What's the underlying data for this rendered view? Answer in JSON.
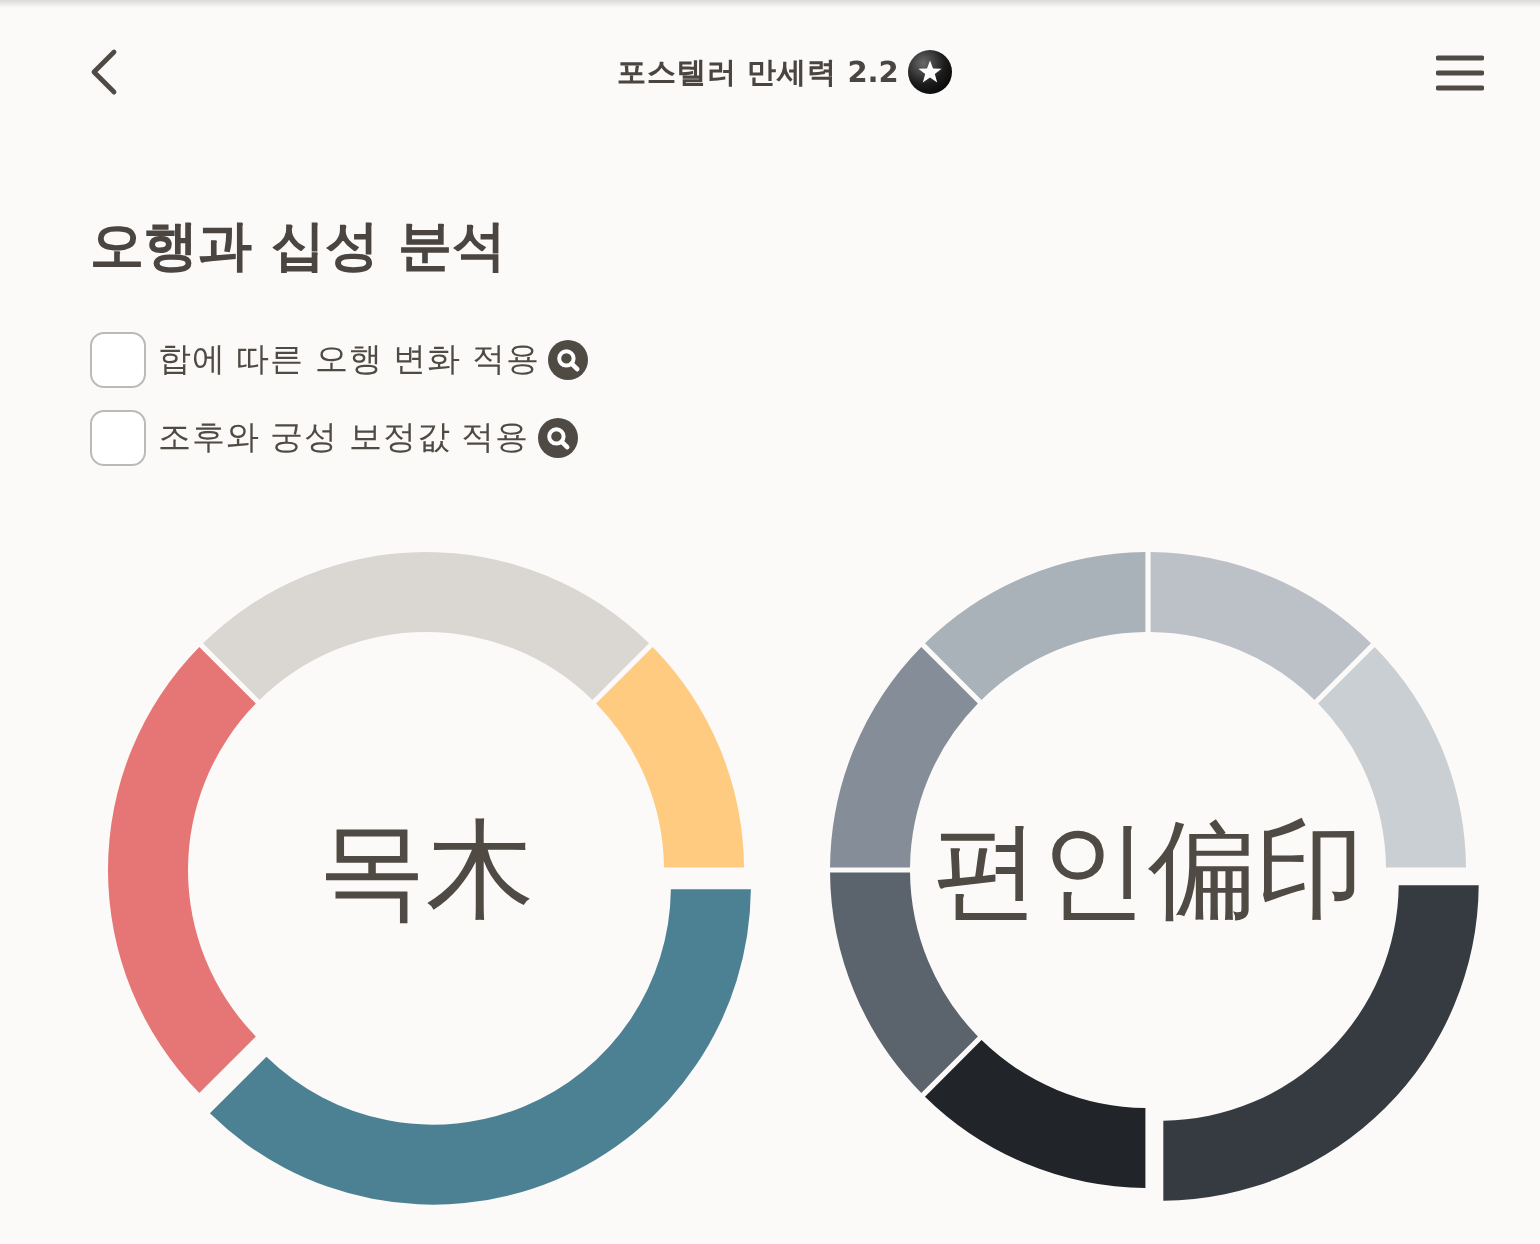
{
  "header": {
    "title": "포스텔러 만세력 2.2"
  },
  "section": {
    "title": "오행과 십성 분석",
    "options": [
      {
        "label": "합에 따른 오행 변화 적용",
        "checked": false
      },
      {
        "label": "조후와 궁성 보정값 적용",
        "checked": false
      }
    ]
  },
  "charts": [
    {
      "center_label": "목木",
      "segments": [
        {
          "color": "#dad7d2",
          "selected": false
        },
        {
          "color": "#ffcb80",
          "selected": false
        },
        {
          "color": "#4c8194",
          "selected": true
        },
        {
          "color": "#e67676",
          "selected": false
        }
      ]
    },
    {
      "center_label": "편인偏印",
      "segments": [
        {
          "color": "#bcc1c8",
          "selected": false
        },
        {
          "color": "#cacfd4",
          "selected": false
        },
        {
          "color": "#363a41",
          "selected": true
        },
        {
          "color": "#212428",
          "selected": false
        },
        {
          "color": "#5b646d",
          "selected": false
        },
        {
          "color": "#858e98",
          "selected": false
        },
        {
          "color": "#a9b1b9",
          "selected": false
        }
      ]
    }
  ]
}
